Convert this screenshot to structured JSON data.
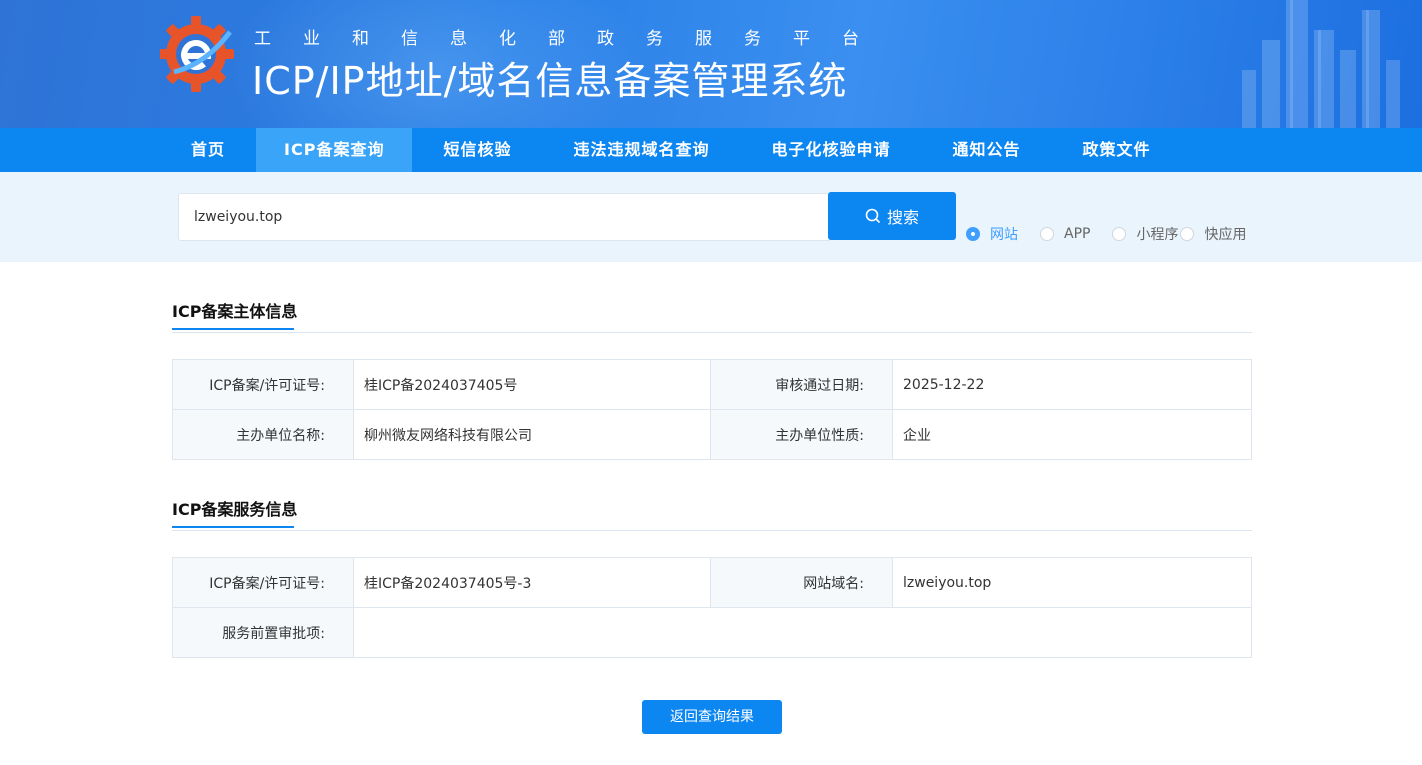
{
  "header": {
    "subtitle": "工业和信息化部政务服务平台",
    "title": "ICP/IP地址/域名信息备案管理系统",
    "logo_icon": "gear-e-logo-icon"
  },
  "nav": {
    "items": [
      {
        "label": "首页",
        "active": false
      },
      {
        "label": "ICP备案查询",
        "active": true
      },
      {
        "label": "短信核验",
        "active": false
      },
      {
        "label": "违法违规域名查询",
        "active": false
      },
      {
        "label": "电子化核验申请",
        "active": false
      },
      {
        "label": "通知公告",
        "active": false
      },
      {
        "label": "政策文件",
        "active": false
      }
    ]
  },
  "search": {
    "value": "lzweiyou.top",
    "button_label": "搜索",
    "button_icon": "search-icon",
    "types": [
      {
        "label": "网站",
        "checked": true
      },
      {
        "label": "APP",
        "checked": false
      },
      {
        "label": "小程序",
        "checked": false
      },
      {
        "label": "快应用",
        "checked": false
      }
    ]
  },
  "subject_info": {
    "title": "ICP备案主体信息",
    "license_label": "ICP备案/许可证号:",
    "license_value": "桂ICP备2024037405号",
    "approve_date_label": "审核通过日期:",
    "approve_date_value": "2025-12-22",
    "org_name_label": "主办单位名称:",
    "org_name_value": "柳州微友网络科技有限公司",
    "org_type_label": "主办单位性质:",
    "org_type_value": "企业"
  },
  "service_info": {
    "title": "ICP备案服务信息",
    "license_label": "ICP备案/许可证号:",
    "license_value": "桂ICP备2024037405号-3",
    "domain_label": "网站域名:",
    "domain_value": "lzweiyou.top",
    "approval_label": "服务前置审批项:",
    "approval_value": ""
  },
  "back_button_label": "返回查询结果",
  "colors": {
    "primary": "#0c86f1",
    "nav_active": "#3aa4f8",
    "radio_checked": "#409eff"
  }
}
